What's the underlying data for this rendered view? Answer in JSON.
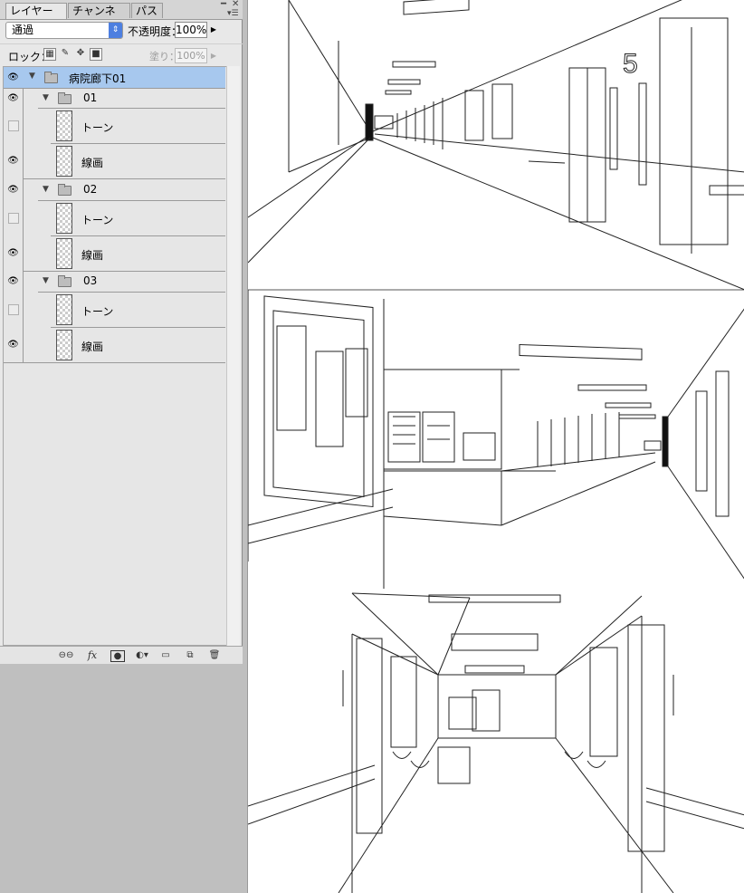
{
  "tabs": [
    {
      "label": "レイヤー",
      "close": "×"
    },
    {
      "label": "チャンネル"
    },
    {
      "label": "パス"
    }
  ],
  "blend_mode": "通過",
  "opacity": {
    "label": "不透明度：",
    "value": "100%"
  },
  "lock": {
    "label": "ロック："
  },
  "fill": {
    "label": "塗り：",
    "value": "100%"
  },
  "layers": [
    {
      "name": "病院廊下01",
      "type": "group",
      "visible": true,
      "selected": true,
      "level": 0
    },
    {
      "name": "01",
      "type": "group",
      "visible": true,
      "level": 1
    },
    {
      "name": "トーン",
      "type": "layer",
      "visible": false,
      "level": 2
    },
    {
      "name": "線画",
      "type": "layer",
      "visible": true,
      "level": 2
    },
    {
      "name": "02",
      "type": "group",
      "visible": true,
      "level": 1
    },
    {
      "name": "トーン",
      "type": "layer",
      "visible": false,
      "level": 2
    },
    {
      "name": "線画",
      "type": "layer",
      "visible": true,
      "level": 2
    },
    {
      "name": "03",
      "type": "group",
      "visible": true,
      "level": 1
    },
    {
      "name": "トーン",
      "type": "layer",
      "visible": false,
      "level": 2
    },
    {
      "name": "線画",
      "type": "layer",
      "visible": true,
      "level": 2
    }
  ],
  "bottom_icons": [
    "link-icon",
    "fx-icon",
    "mask-icon",
    "adjustment-icon",
    "new-group-icon",
    "new-layer-icon",
    "trash-icon"
  ],
  "bottom_labels": {
    "fx": "fx"
  },
  "sign_number": "5"
}
